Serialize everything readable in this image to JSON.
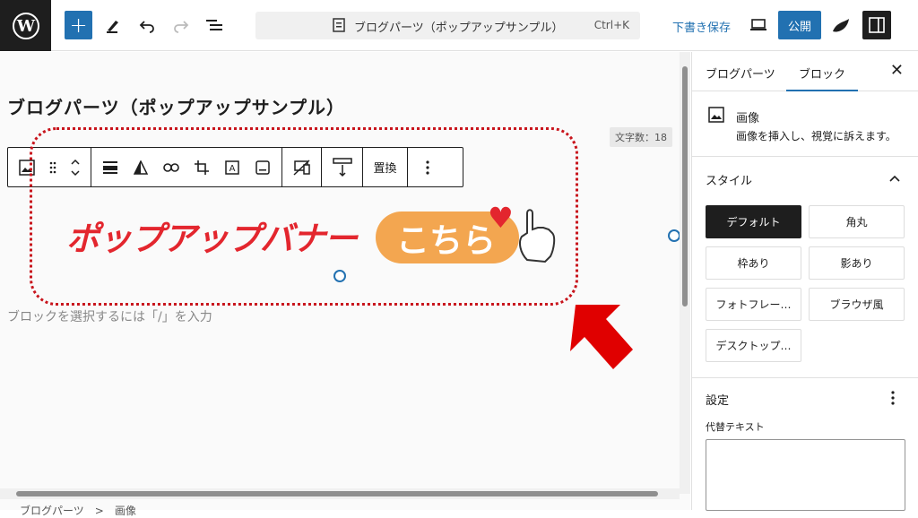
{
  "topbar": {
    "document_title": "ブログパーツ（ポップアップサンプル）",
    "shortcut": "Ctrl+K",
    "save_draft_label": "下書き保存",
    "publish_label": "公開"
  },
  "canvas": {
    "page_title": "ブログパーツ（ポップアップサンプル）",
    "char_count": "文字数：18",
    "toolbar_replace_label": "置換",
    "banner_text": "ポップアップバナー",
    "banner_cta": "こちら",
    "placeholder": "ブロックを選択するには「/」を入力",
    "breadcrumb": "ブログパーツ　>　画像"
  },
  "sidebar": {
    "tabs": [
      {
        "label": "ブログパーツ"
      },
      {
        "label": "ブロック"
      }
    ],
    "active_tab": "ブロック",
    "block_name": "画像",
    "block_description": "画像を挿入し、視覚に訴えます。",
    "styles_title": "スタイル",
    "styles": [
      {
        "label": "デフォルト",
        "active": true
      },
      {
        "label": "角丸",
        "active": false
      },
      {
        "label": "枠あり",
        "active": false
      },
      {
        "label": "影あり",
        "active": false
      },
      {
        "label": "フォトフレー…",
        "active": false
      },
      {
        "label": "ブラウザ風",
        "active": false
      },
      {
        "label": "デスクトップ…",
        "active": false
      }
    ],
    "settings_title": "設定",
    "alt_text_label": "代替テキスト"
  },
  "colors": {
    "accent": "#2271b1",
    "annotation_red": "#c8141c",
    "banner_red": "#e3262e",
    "banner_orange": "#f3a650"
  }
}
